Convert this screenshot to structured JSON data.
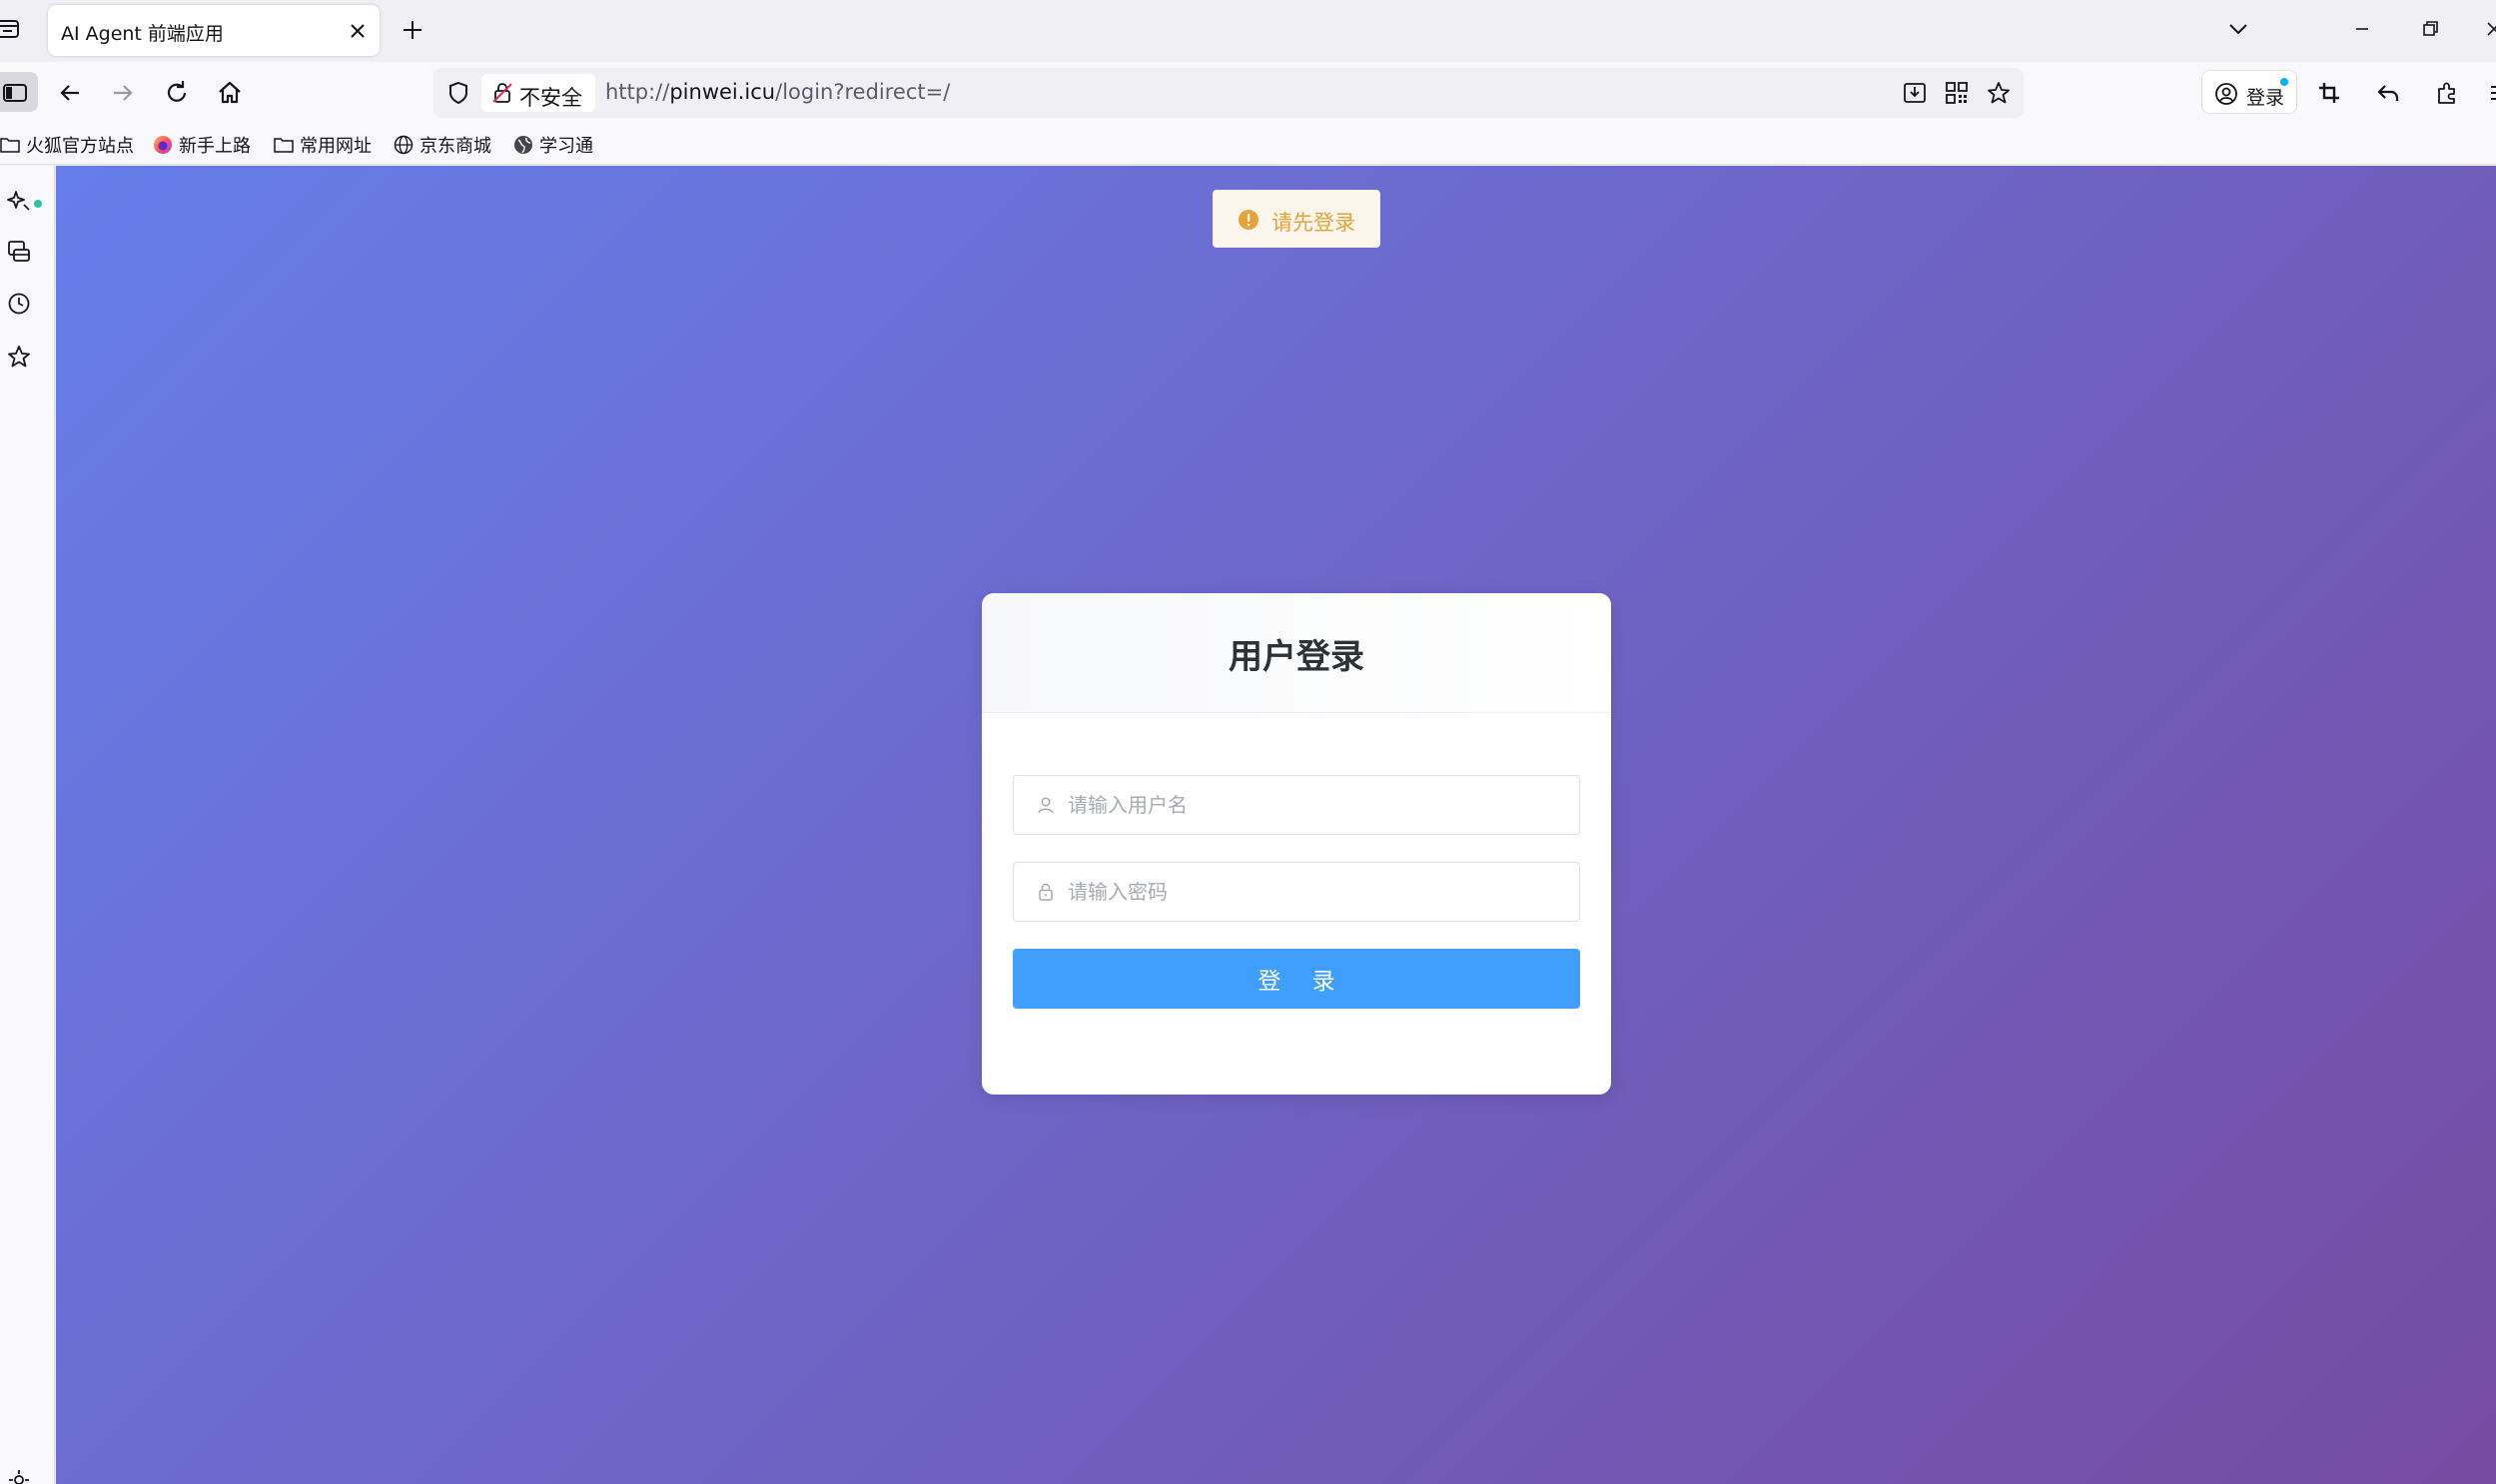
{
  "browser": {
    "tab": {
      "title": "AI Agent 前端应用"
    },
    "urlbar": {
      "security_label": "不安全",
      "url_prefix": "http://",
      "url_host": "pinwei.icu",
      "url_path": "/login?redirect=/"
    },
    "account_label": "登录",
    "bookmarks": [
      {
        "label": "火狐官方站点",
        "icon": "folder-icon"
      },
      {
        "label": "新手上路",
        "icon": "firefox-icon"
      },
      {
        "label": "常用网址",
        "icon": "folder-icon"
      },
      {
        "label": "京东商城",
        "icon": "globe-icon"
      },
      {
        "label": "学习通",
        "icon": "globe-icon"
      }
    ]
  },
  "page": {
    "toast": {
      "message": "请先登录",
      "type": "warning",
      "color": "#e6a23c"
    },
    "login": {
      "title": "用户登录",
      "username_placeholder": "请输入用户名",
      "password_placeholder": "请输入密码",
      "submit_label": "登 录"
    }
  },
  "colors": {
    "gradient_start": "#667eea",
    "gradient_end": "#764ba2",
    "primary_button": "#409eff"
  }
}
